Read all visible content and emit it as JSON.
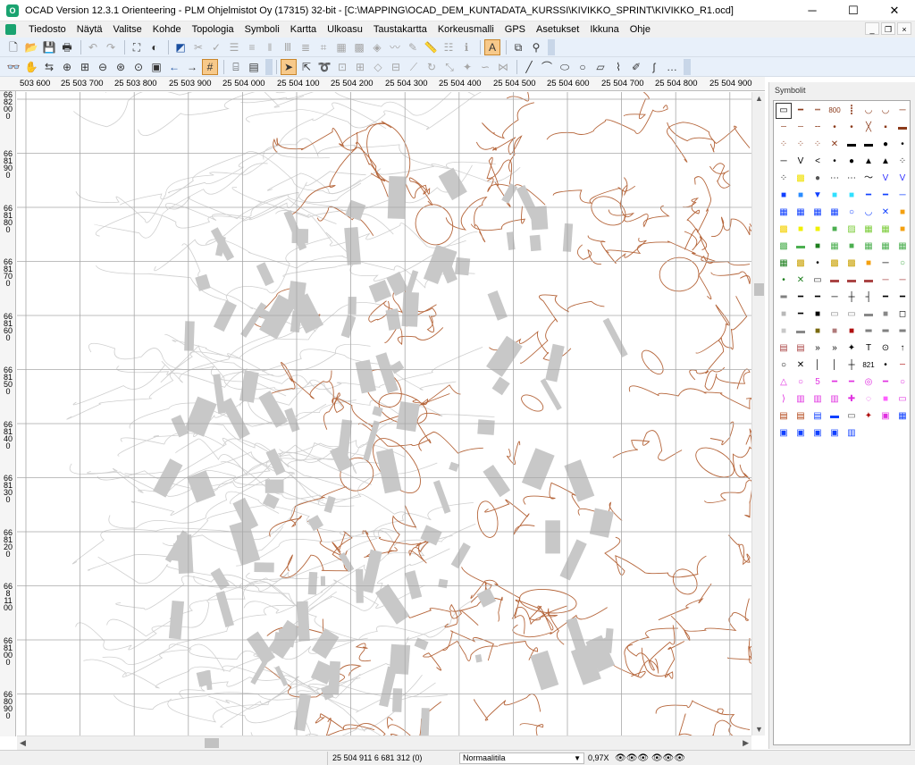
{
  "app": {
    "title": "OCAD Version 12.3.1  Orienteering - PLM Ohjelmistot Oy (17315) 32-bit - [C:\\MAPPING\\OCAD_DEM_KUNTADATA_KURSSI\\KIVIKKO_SPRINT\\KIVIKKO_R1.ocd]",
    "icon_text": "O",
    "minimize": "─",
    "maximize": "☐",
    "close": "✕"
  },
  "menu": {
    "items": [
      "Tiedosto",
      "Näytä",
      "Valitse",
      "Kohde",
      "Topologia",
      "Symboli",
      "Kartta",
      "Ulkoasu",
      "Taustakartta",
      "Korkeusmalli",
      "GPS",
      "Asetukset",
      "Ikkuna",
      "Ohje"
    ],
    "mdi_minimize": "_",
    "mdi_restore": "❐",
    "mdi_close": "×"
  },
  "rulers": {
    "top_labels": [
      "503 600",
      "25 503 700",
      "25 503 800",
      "25 503 900",
      "25 504 000",
      "25 504 100",
      "25 504 200",
      "25 504 300",
      "25 504 400",
      "25 504 500",
      "25 504 600",
      "25 504 700",
      "25 504 800",
      "25 504 900"
    ],
    "left_labels": [
      "6682000",
      "6681900",
      "6681800",
      "6681700",
      "6681600",
      "6681500",
      "6681400",
      "6681300",
      "6681200",
      "6681100",
      "6681000",
      "6680900"
    ]
  },
  "symbols_panel": {
    "title": "Symbolit"
  },
  "status": {
    "coordinates": "25 504 911   6 681 312  (0)",
    "mode": "Normaalitila",
    "zoom": "0,97X"
  },
  "colors": {
    "contour": "#b5653a",
    "building": "#c8c8c8",
    "grid": "#a8a8a8",
    "background_lines": "#cfcfcf",
    "toolbar_bg": "#e8f0fa",
    "accent": "#1aa370"
  }
}
